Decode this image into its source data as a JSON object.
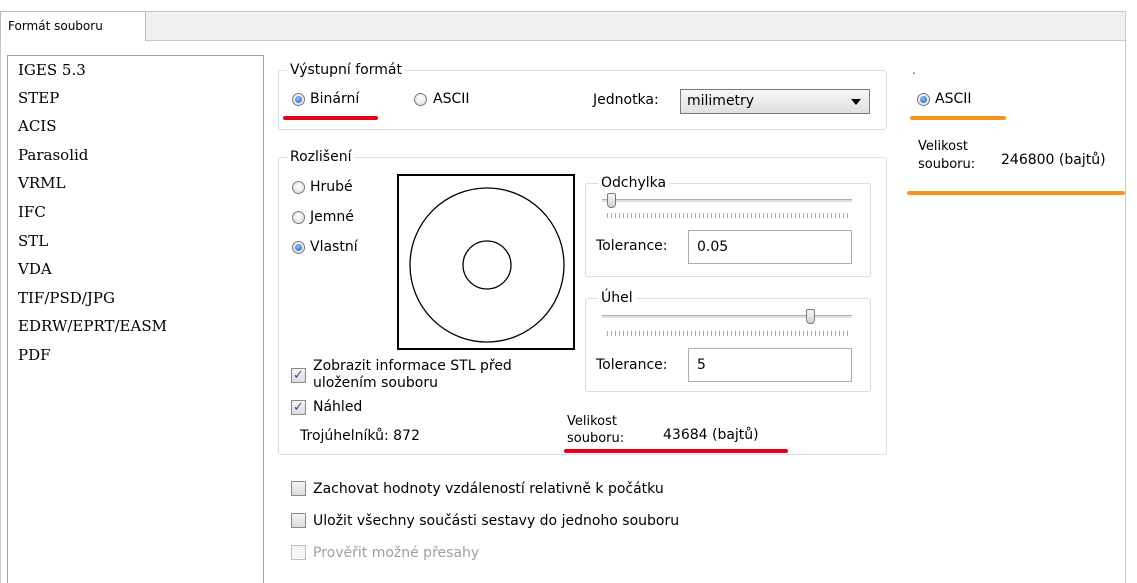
{
  "tab": {
    "label": "Formát souboru"
  },
  "formats": [
    "IGES 5.3",
    "STEP",
    "ACIS",
    "Parasolid",
    "VRML",
    "IFC",
    "STL",
    "VDA",
    "TIF/PSD/JPG",
    "EDRW/EPRT/EASM",
    "PDF"
  ],
  "output_format": {
    "legend": "Výstupní formát",
    "binary_label": "Binární",
    "ascii_label": "ASCII",
    "selected": "Binární",
    "unit_label": "Jednotka:",
    "unit_value": "milimetry"
  },
  "resolution": {
    "legend": "Rozlišení",
    "coarse_label": "Hrubé",
    "fine_label": "Jemné",
    "custom_label": "Vlastní",
    "selected": "Vlastní"
  },
  "deviation": {
    "legend": "Odchylka",
    "tolerance_label": "Tolerance:",
    "tolerance_value": "0.05",
    "slider_level": 0.03
  },
  "angle": {
    "legend": "Úhel",
    "tolerance_label": "Tolerance:",
    "tolerance_value": "5",
    "slider_level": 0.85
  },
  "options": {
    "show_info_line1": "Zobrazit informace STL před",
    "show_info_line2": "uložením souboru",
    "show_info_checked": true,
    "preview_label": "Náhled",
    "preview_checked": true,
    "triangles_text": "Trojúhelníků: 872"
  },
  "file_size": {
    "label_line1": "Velikost",
    "label_line2": "souboru:",
    "value": "43684 (bajtů)"
  },
  "bottom_options": {
    "keep_distances_label": "Zachovat hodnoty vzdáleností relativně k počátku",
    "save_all_label": "Uložit všechny součásti sestavy do jednoho souboru",
    "check_overlaps_label": "Prověřit možné přesahy"
  },
  "comparison": {
    "dot": ".",
    "ascii_label": "ASCII",
    "size_label_line1": "Velikost",
    "size_label_line2": "souboru:",
    "size_value": "246800 (bajtů)"
  },
  "colors": {
    "red_highlight": "#e8001c",
    "orange_highlight": "#f7941d",
    "group_border": "#d5dfe5"
  }
}
